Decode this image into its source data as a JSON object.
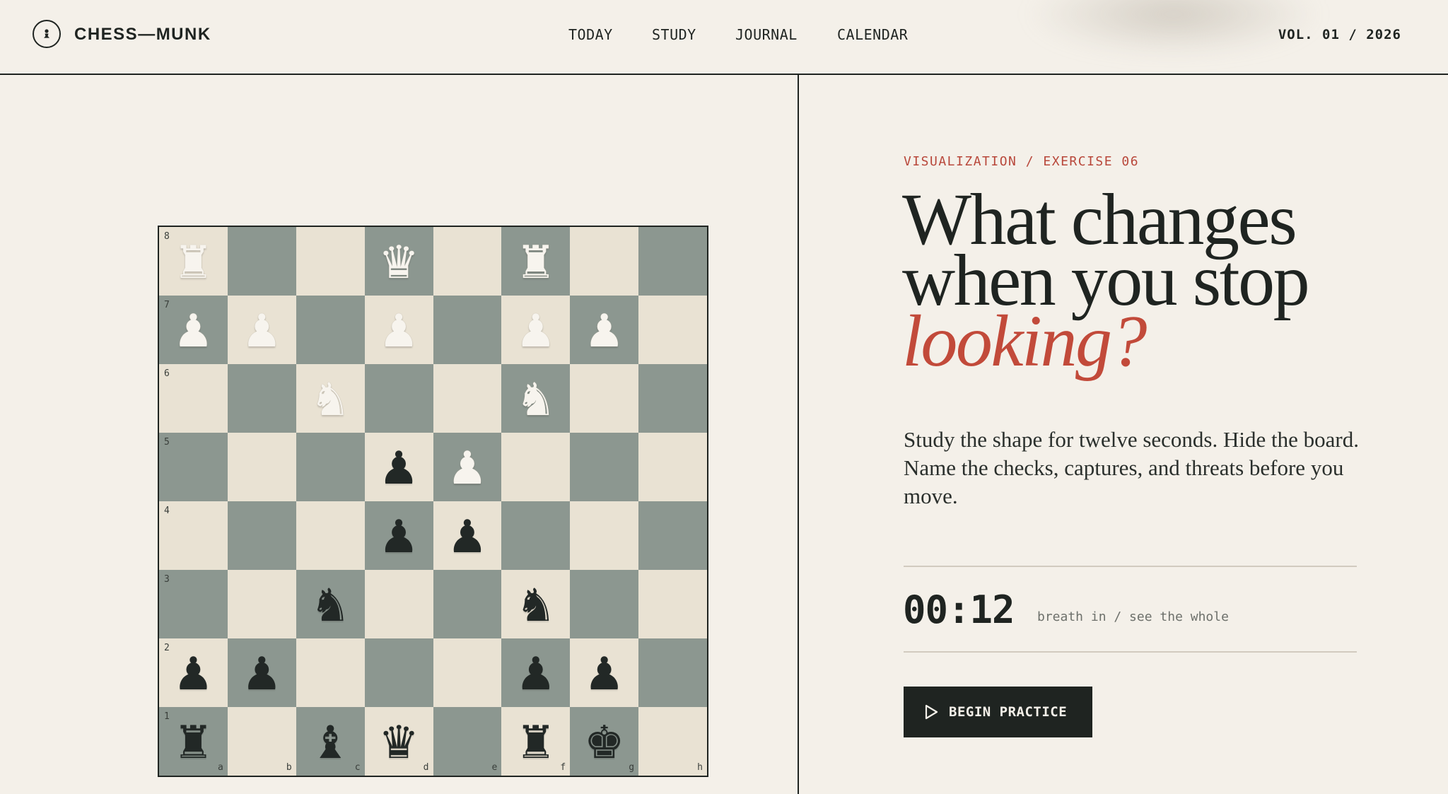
{
  "brand": {
    "name": "CHESS—MUNK",
    "logo_icon": "pawn-icon"
  },
  "nav": [
    {
      "label": "TODAY"
    },
    {
      "label": "STUDY"
    },
    {
      "label": "JOURNAL"
    },
    {
      "label": "CALENDAR"
    }
  ],
  "volume": "VOL. 01 / 2026",
  "exercise": {
    "kicker": "VISUALIZATION / EXERCISE 06",
    "headline_line1": "What changes",
    "headline_line2": "when you stop",
    "headline_accent": "looking?",
    "lede": "Study the shape for twelve seconds. Hide the board. Name the checks, captures, and threats before you move.",
    "timer": "00:12",
    "timer_note": "breath in / see the whole",
    "cta_label": "BEGIN PRACTICE",
    "cta_icon": "play-icon"
  },
  "board": {
    "files": [
      "a",
      "b",
      "c",
      "d",
      "e",
      "f",
      "g",
      "h"
    ],
    "ranks": [
      "8",
      "7",
      "6",
      "5",
      "4",
      "3",
      "2",
      "1"
    ],
    "rows": [
      [
        "R",
        "",
        "",
        "Q",
        "",
        "R",
        "",
        ""
      ],
      [
        "P",
        "P",
        "",
        "P",
        "",
        "P",
        "P",
        ""
      ],
      [
        "",
        "",
        "N",
        "",
        "",
        "N",
        "",
        ""
      ],
      [
        "",
        "",
        "",
        "p",
        "P",
        "",
        "",
        ""
      ],
      [
        "",
        "",
        "",
        "p",
        "p",
        "",
        "",
        ""
      ],
      [
        "",
        "",
        "n",
        "",
        "",
        "n",
        "",
        ""
      ],
      [
        "p",
        "p",
        "",
        "",
        "",
        "p",
        "p",
        ""
      ],
      [
        "r",
        "",
        "b",
        "q",
        "",
        "r",
        "k",
        ""
      ]
    ]
  },
  "colors": {
    "background": "#f4f0e9",
    "ink": "#1f2421",
    "accent": "#c24a3a",
    "light_square": "#e9e2d3",
    "dark_square": "#8c9790"
  }
}
